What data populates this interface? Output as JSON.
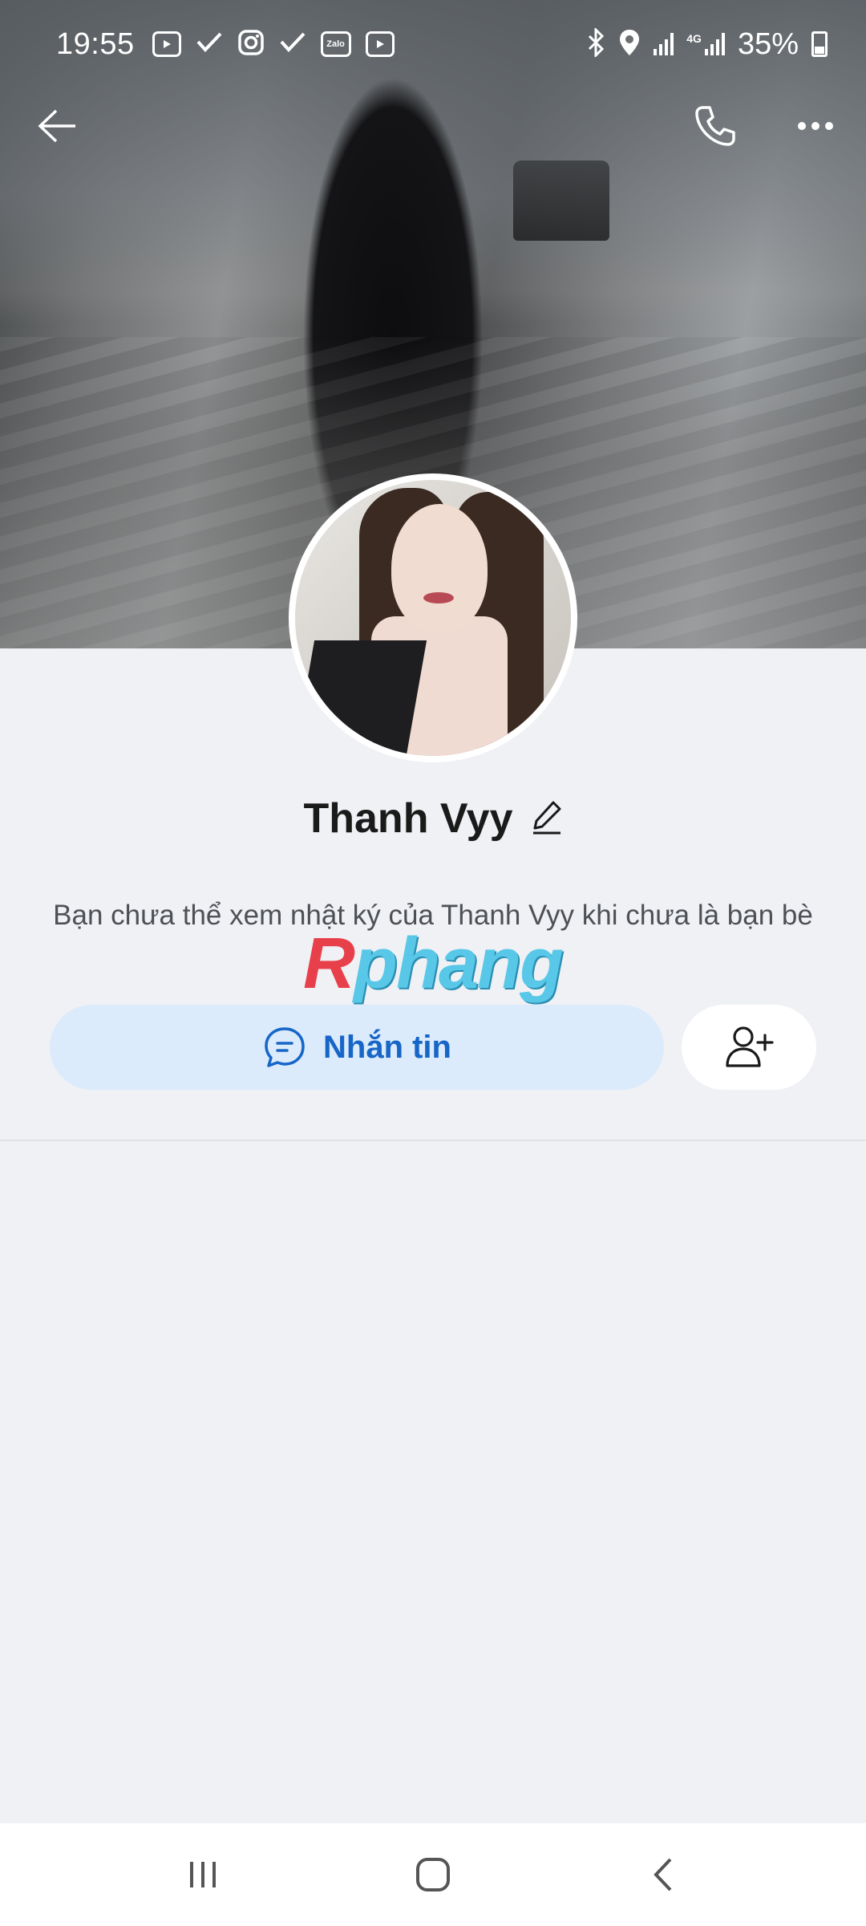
{
  "status_bar": {
    "time": "19:55",
    "battery": "35%",
    "battery_level": 0.35,
    "network": "4G",
    "zalo_badge": "Zalo",
    "left_icons": [
      "youtube-icon",
      "check-icon",
      "instagram-icon",
      "check-icon",
      "zalo-icon",
      "youtube-icon"
    ],
    "right_icons": [
      "bluetooth-icon",
      "location-icon",
      "signal-icon",
      "4g-signal-icon",
      "battery-icon"
    ]
  },
  "top_nav": {
    "back_icon": "arrow-left-icon",
    "call_icon": "phone-icon",
    "more_icon": "more-horizontal-icon"
  },
  "profile": {
    "name": "Thanh Vyy",
    "edit_icon": "pencil-icon",
    "info_text": "Bạn chưa thể xem nhật ký của Thanh Vyy khi chưa là bạn bè"
  },
  "watermark": {
    "first": "R",
    "rest": "phang"
  },
  "actions": {
    "message_label": "Nhắn tin",
    "message_icon": "chat-bubble-icon",
    "add_friend_icon": "add-user-icon"
  },
  "colors": {
    "background": "#f0f1f5",
    "accent": "#1766c7",
    "accent_light": "#dbebfc",
    "text_primary": "#1a1a1a",
    "text_secondary": "#4d5155"
  },
  "system_nav": [
    "recents-icon",
    "home-icon",
    "back-icon"
  ]
}
